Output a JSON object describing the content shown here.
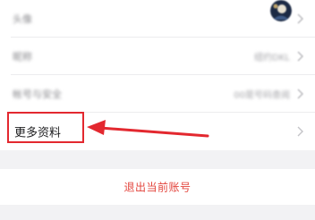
{
  "settings": {
    "rows": [
      {
        "label": "头像",
        "value": ""
      },
      {
        "label": "昵称",
        "value": "纽约DKL"
      },
      {
        "label": "帐号与安全",
        "value": "00是号码查阅"
      },
      {
        "label": "更多资料",
        "value": ""
      }
    ]
  },
  "logout": {
    "label": "退出当前账号"
  },
  "colors": {
    "background": "#f2f2f4",
    "card": "#ffffff",
    "annotation_red": "#e3282f",
    "logout_text": "#e3453d"
  }
}
